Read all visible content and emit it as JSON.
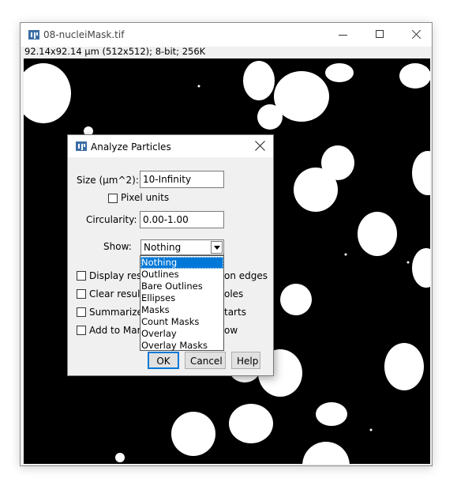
{
  "image_window": {
    "title": "08-nucleiMask.tif",
    "info": "92.14x92.14 µm (512x512); 8-bit; 256K",
    "app_icon": "imagej-icon",
    "controls": {
      "minimize": "minimize-icon",
      "maximize": "maximize-icon",
      "close": "close-icon"
    }
  },
  "dialog": {
    "title": "Analyze Particles",
    "size_label": "Size (µm^2):",
    "size_value": "10-Infinity",
    "pixel_units_label": "Pixel units",
    "pixel_units_checked": false,
    "circularity_label": "Circularity:",
    "circularity_value": "0.00-1.00",
    "show_label": "Show:",
    "show_value": "Nothing",
    "show_options": [
      "Nothing",
      "Outlines",
      "Bare Outlines",
      "Ellipses",
      "Masks",
      "Count Masks",
      "Overlay",
      "Overlay Masks"
    ],
    "show_selected_index": 0,
    "checkboxes_left": [
      {
        "label": "Display resu",
        "checked": false
      },
      {
        "label": "Clear result",
        "checked": false
      },
      {
        "label": "Summarize",
        "checked": false
      },
      {
        "label": "Add to Mana",
        "checked": false
      }
    ],
    "checkboxes_right_visible_text": [
      "on edges",
      "oles",
      "tarts",
      "ow"
    ],
    "buttons": {
      "ok": "OK",
      "cancel": "Cancel",
      "help": "Help"
    }
  },
  "colors": {
    "accent": "#0078d7",
    "window_bg": "#f0f0f0",
    "canvas_bg": "#000000",
    "particle": "#ffffff"
  }
}
